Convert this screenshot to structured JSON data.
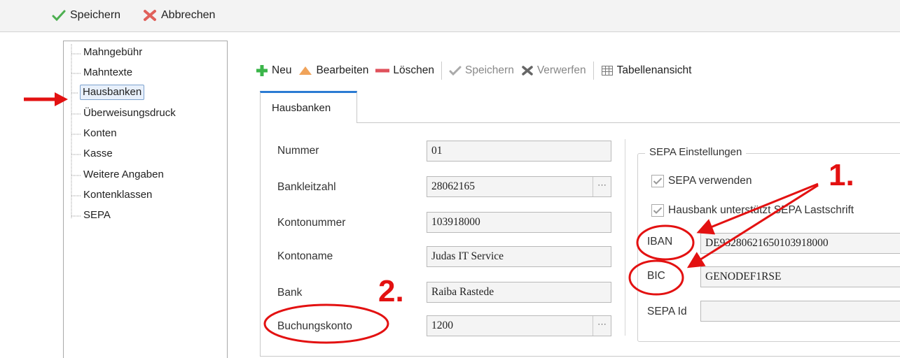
{
  "window_toolbar": {
    "save_label": "Speichern",
    "cancel_label": "Abbrechen"
  },
  "tree": {
    "items": [
      {
        "label": "Mahngebühr"
      },
      {
        "label": "Mahntexte"
      },
      {
        "label": "Hausbanken",
        "selected": true
      },
      {
        "label": "Überweisungsdruck"
      },
      {
        "label": "Konten"
      },
      {
        "label": "Kasse"
      },
      {
        "label": "Weitere Angaben"
      },
      {
        "label": "Kontenklassen"
      },
      {
        "label": "SEPA"
      }
    ]
  },
  "toolbar": {
    "new_label": "Neu",
    "edit_label": "Bearbeiten",
    "delete_label": "Löschen",
    "save_label": "Speichern",
    "discard_label": "Verwerfen",
    "table_view_label": "Tabellenansicht"
  },
  "tab": {
    "label": "Hausbanken"
  },
  "form": {
    "nummer": {
      "label": "Nummer",
      "value": "01"
    },
    "bankleitzahl": {
      "label": "Bankleitzahl",
      "value": "28062165"
    },
    "kontonummer": {
      "label": "Kontonummer",
      "value": "103918000"
    },
    "kontoname": {
      "label": "Kontoname",
      "value": "Judas IT Service"
    },
    "bank": {
      "label": "Bank",
      "value": "Raiba Rastede"
    },
    "buchungskonto": {
      "label": "Buchungskonto",
      "value": "1200"
    }
  },
  "sepa": {
    "group_title": "SEPA Einstellungen",
    "use_sepa": {
      "label": "SEPA verwenden",
      "checked": true
    },
    "lastschrift": {
      "label": "Hausbank unterstützt SEPA Lastschrift",
      "checked": true
    },
    "iban": {
      "label": "IBAN",
      "value": "DE93280621650103918000"
    },
    "bic": {
      "label": "BIC",
      "value": "GENODEF1RSE"
    },
    "sepa_id": {
      "label": "SEPA Id",
      "value": ""
    }
  },
  "annotations": {
    "one": "1.",
    "two": "2."
  },
  "colors": {
    "accent": "#2b7bd3",
    "annotation_red": "#e31111",
    "new_green": "#3bb54a",
    "edit_orange": "#f0a35a",
    "delete_red": "#e0525c"
  }
}
